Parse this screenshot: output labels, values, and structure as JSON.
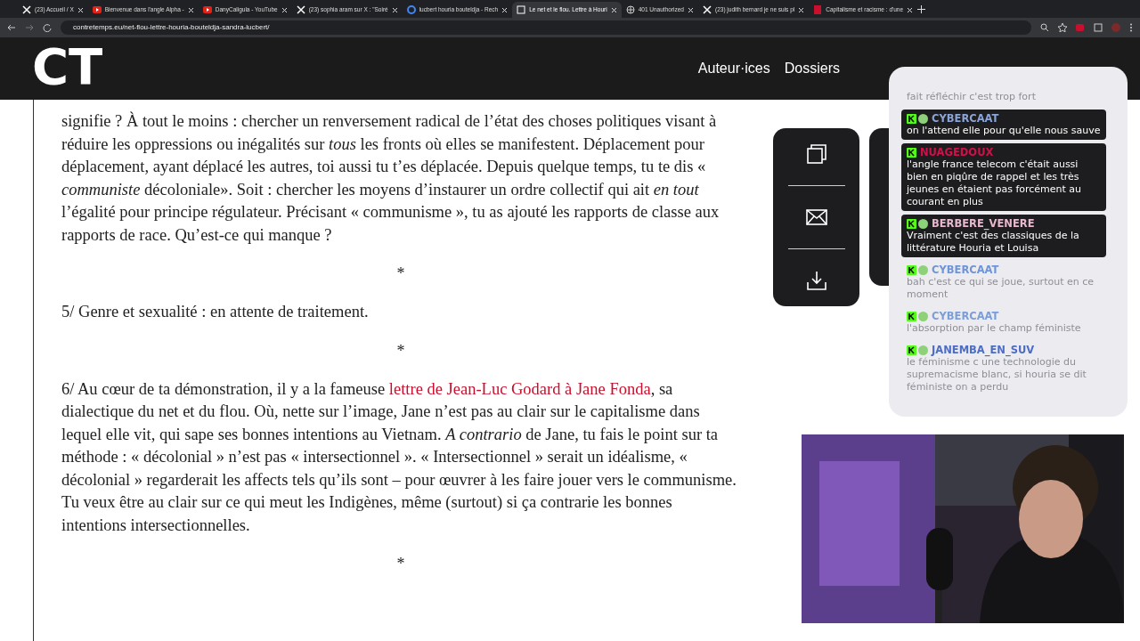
{
  "browser": {
    "tabs": [
      {
        "title": "(23) Accueil / X",
        "selected": false
      },
      {
        "title": "Bienvenue dans l'angle Alpha -",
        "selected": false
      },
      {
        "title": "DanyCaligula - YouTube",
        "selected": false
      },
      {
        "title": "(23) sophia aram sur X : \"Soiré",
        "selected": false
      },
      {
        "title": "lucbert houria bouteldja - Rech",
        "selected": false
      },
      {
        "title": "Le net et le flou. Lettre à Houri",
        "selected": true
      },
      {
        "title": "401 Unauthorized",
        "selected": false
      },
      {
        "title": "(23) judith bernard je ne suis pl",
        "selected": false
      },
      {
        "title": "Capitalisme et racisme : d'une",
        "selected": false
      }
    ],
    "url": "contretemps.eu/net-flou-lettre-houria-bouteldja-sandra-lucbert/"
  },
  "site": {
    "logo": "CT",
    "nav": [
      "Auteur·ices",
      "Dossiers"
    ]
  },
  "article": {
    "blocks": [
      {
        "kind": "paragraph",
        "text": "signifie ? À tout le moins : chercher un renversement radical de l’état des choses politiques visant à réduire les oppressions ou inégalités sur *tous* les fronts où elles se manifestent. Déplacement pour déplacement, ayant déplacé les autres, toi aussi tu t’es déplacée. Depuis quelque temps, tu te dis « *communiste* décoloniale». Soit : chercher les moyens d’instaurer un ordre collectif qui ait *en tout* l’égalité pour principe régulateur. Précisant « communisme », tu as ajouté les rapports de classe aux rapports de race. Qu’est-ce qui manque ?"
      },
      {
        "kind": "separator",
        "text": "*"
      },
      {
        "kind": "paragraph",
        "text": "5/ Genre et sexualité : en attente de traitement."
      },
      {
        "kind": "separator",
        "text": "*"
      },
      {
        "kind": "paragraph",
        "text": "6/ Au cœur de ta démonstration, il y a la fameuse ",
        "link": "lettre de Jean-Luc Godard à Jane Fonda",
        "after": ", sa dialectique du net et du flou. Où, nette sur l’image, Jane n’est pas au clair sur le capitalisme dans lequel elle vit, qui sape ses bonnes intentions au Vietnam. *A contrario* de Jane, tu fais le point sur ta méthode : « décolonial » n’est pas « intersectionnel ». « Intersectionnel » serait un idéalisme, « décolonial » regarderait les affects tels qu’ils sont – pour œuvrer à les faire jouer vers le communisme. Tu veux être au clair sur ce qui meut les Indigènes, même (surtout) si ça contrarie les bonnes intentions intersectionnelles."
      },
      {
        "kind": "separator",
        "text": "*"
      }
    ]
  },
  "chat": {
    "messages": [
      {
        "text": "fait réfléchir c'est trop fort",
        "faded": true
      },
      {
        "name": "CYBERCAAT",
        "color": "#8aa4d6",
        "avatar": true,
        "text": "on l'attend elle pour qu'elle nous sauve",
        "faded": false
      },
      {
        "name": "NUAGEDOUX",
        "color": "#d0104a",
        "avatar": false,
        "text": "l'angle france telecom c'était aussi bien en piqûre de rappel et les très jeunes en étaient pas forcément au courant en plus",
        "faded": false
      },
      {
        "name": "BERBERE_VENERE",
        "color": "#e8b8cc",
        "avatar": true,
        "text": "Vraiment c'est des classiques de la littérature Houria et Louisa",
        "faded": false
      },
      {
        "name": "CYBERCAAT",
        "color": "#6f94d8",
        "avatar": true,
        "text": "bah c'est ce qui se joue, surtout en ce moment",
        "faded": true
      },
      {
        "name": "CYBERCAAT",
        "color": "#7c9ed8",
        "avatar": true,
        "text": "l'absorption par le champ féministe",
        "faded": true
      },
      {
        "name": "JANEMBA_EN_SUV",
        "color": "#4d6cc4",
        "avatar": true,
        "text": "le féminisme c une technologie du supremacisme blanc, si houria se dit féministe on a perdu",
        "faded": true
      }
    ]
  }
}
